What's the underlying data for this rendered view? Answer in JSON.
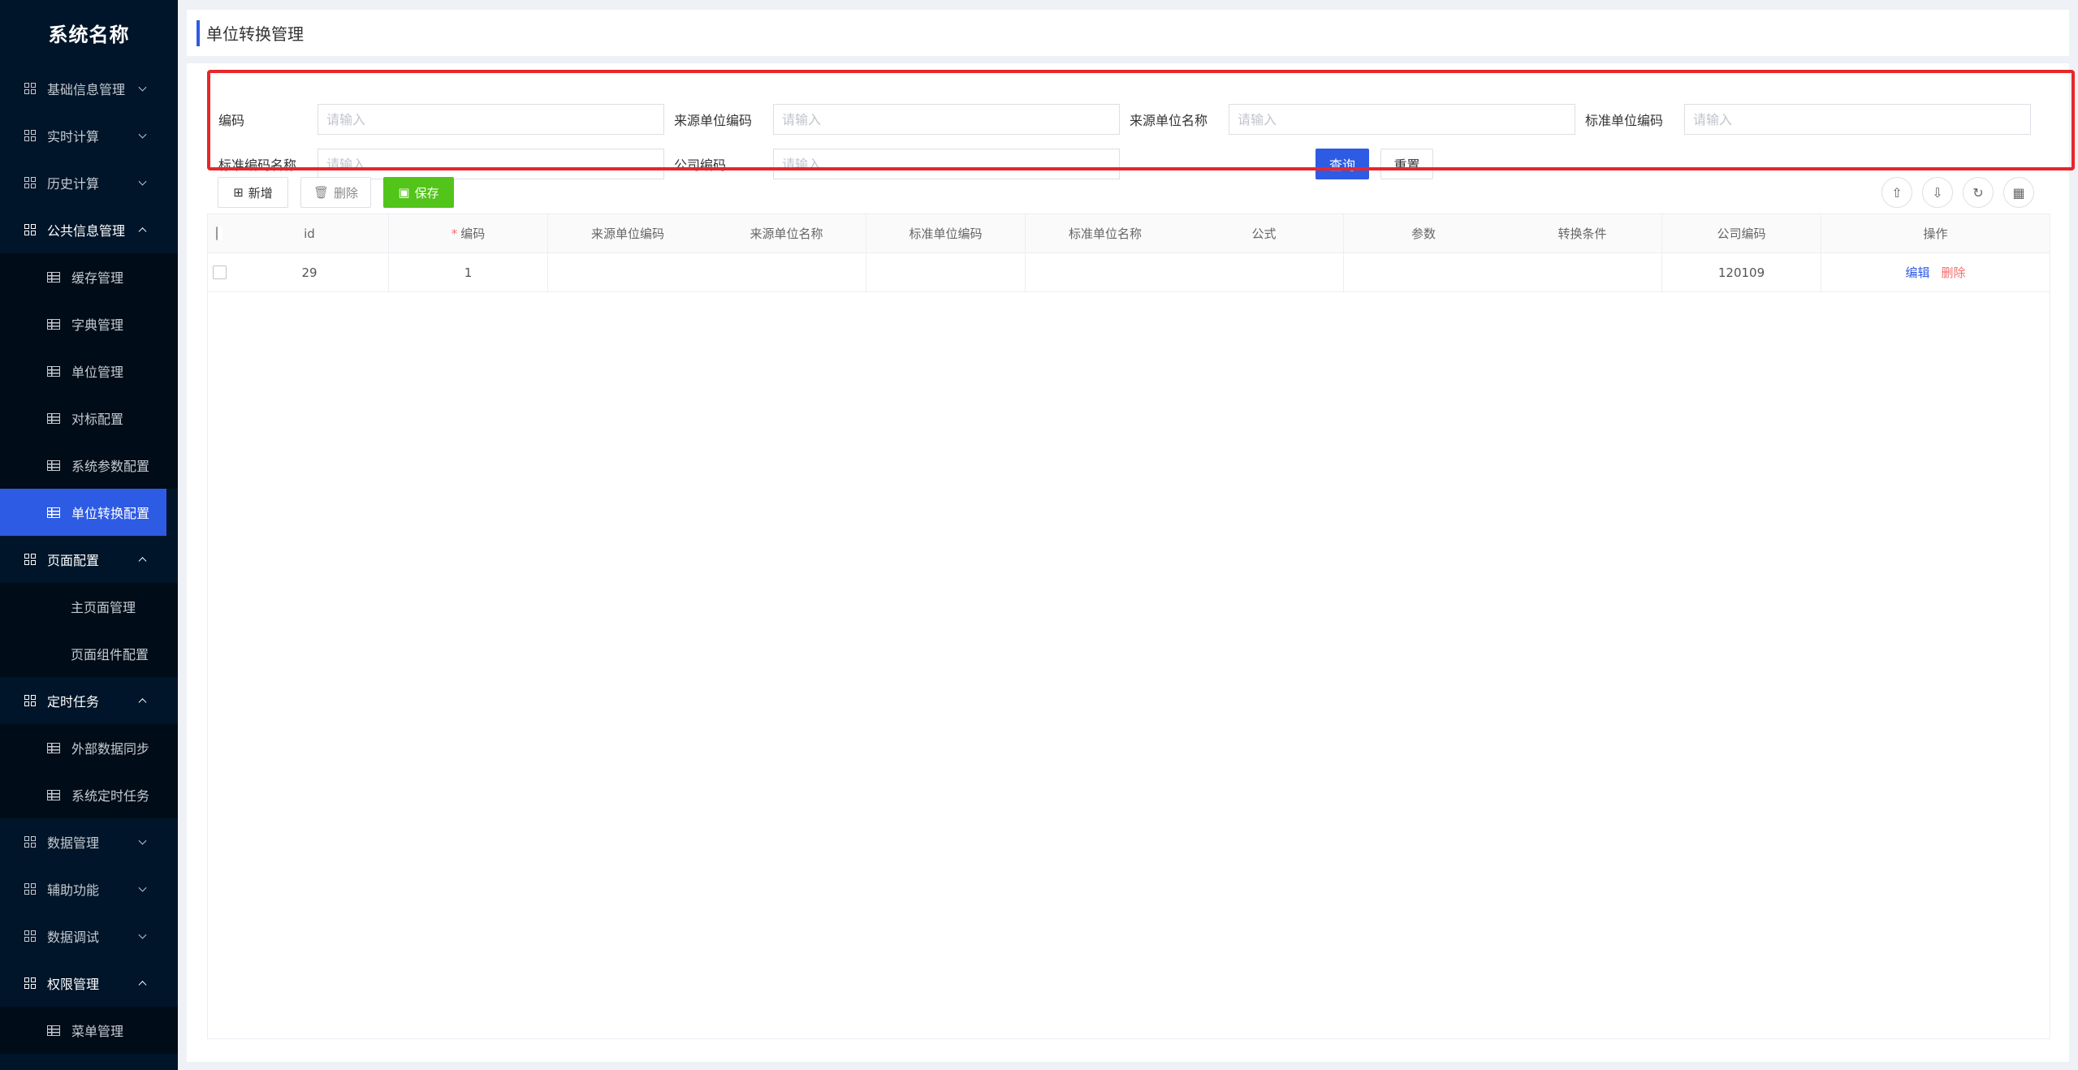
{
  "app": {
    "title": "系统名称"
  },
  "sidebar": {
    "items": [
      {
        "label": "基础信息管理",
        "level": 1,
        "icon": "grid-icon",
        "expanded": false
      },
      {
        "label": "实时计算",
        "level": 1,
        "icon": "grid-icon",
        "expanded": false
      },
      {
        "label": "历史计算",
        "level": 1,
        "icon": "grid-icon",
        "expanded": false
      },
      {
        "label": "公共信息管理",
        "level": 1,
        "icon": "grid-icon",
        "expanded": true
      },
      {
        "label": "缓存管理",
        "level": 2,
        "icon": "table-icon"
      },
      {
        "label": "字典管理",
        "level": 2,
        "icon": "table-icon"
      },
      {
        "label": "单位管理",
        "level": 2,
        "icon": "table-icon"
      },
      {
        "label": "对标配置",
        "level": 2,
        "icon": "table-icon"
      },
      {
        "label": "系统参数配置",
        "level": 2,
        "icon": "table-icon"
      },
      {
        "label": "单位转换配置",
        "level": 2,
        "icon": "table-icon",
        "active": true
      },
      {
        "label": "页面配置",
        "level": 1,
        "icon": "grid-icon",
        "expanded": true
      },
      {
        "label": "主页面管理",
        "level": 2,
        "icon": ""
      },
      {
        "label": "页面组件配置",
        "level": 2,
        "icon": ""
      },
      {
        "label": "定时任务",
        "level": 1,
        "icon": "grid-icon",
        "expanded": true
      },
      {
        "label": "外部数据同步",
        "level": 2,
        "icon": "table-icon"
      },
      {
        "label": "系统定时任务",
        "level": 2,
        "icon": "table-icon"
      },
      {
        "label": "数据管理",
        "level": 1,
        "icon": "grid-icon",
        "expanded": false
      },
      {
        "label": "辅助功能",
        "level": 1,
        "icon": "grid-icon",
        "expanded": false
      },
      {
        "label": "数据调试",
        "level": 1,
        "icon": "grid-icon",
        "expanded": false
      },
      {
        "label": "权限管理",
        "level": 1,
        "icon": "grid-icon",
        "expanded": true
      },
      {
        "label": "菜单管理",
        "level": 2,
        "icon": "table-icon"
      }
    ]
  },
  "header": {
    "title": "单位转换管理"
  },
  "search": {
    "fields": [
      {
        "label": "编码",
        "placeholder": "请输入",
        "value": ""
      },
      {
        "label": "来源单位编码",
        "placeholder": "请输入",
        "value": ""
      },
      {
        "label": "来源单位名称",
        "placeholder": "请输入",
        "value": ""
      },
      {
        "label": "标准单位编码",
        "placeholder": "请输入",
        "value": ""
      },
      {
        "label": "标准编码名称",
        "placeholder": "请输入",
        "value": ""
      },
      {
        "label": "公司编码",
        "placeholder": "请输入",
        "value": ""
      }
    ],
    "query_label": "查询",
    "reset_label": "重置"
  },
  "toolbar": {
    "add_label": "新增",
    "delete_label": "删除",
    "save_label": "保存",
    "icons": [
      "upload-icon",
      "download-icon",
      "refresh-icon",
      "columns-icon"
    ]
  },
  "table": {
    "columns": [
      "id",
      "编码",
      "来源单位编码",
      "来源单位名称",
      "标准单位编码",
      "标准单位名称",
      "公式",
      "参数",
      "转换条件",
      "公司编码",
      "操作"
    ],
    "required_column": "编码",
    "rows": [
      {
        "id": "29",
        "code": "1",
        "src_code": "",
        "src_name": "",
        "std_code": "",
        "std_name": "",
        "formula": "",
        "param": "",
        "condition": "",
        "company": "120109",
        "edit": "编辑",
        "delete": "删除"
      }
    ]
  },
  "colors": {
    "sidebar_bg": "#001529",
    "accent": "#2e5be4",
    "save_green": "#52c41a",
    "danger": "#f56c6c",
    "highlight_red": "#e8262b"
  }
}
